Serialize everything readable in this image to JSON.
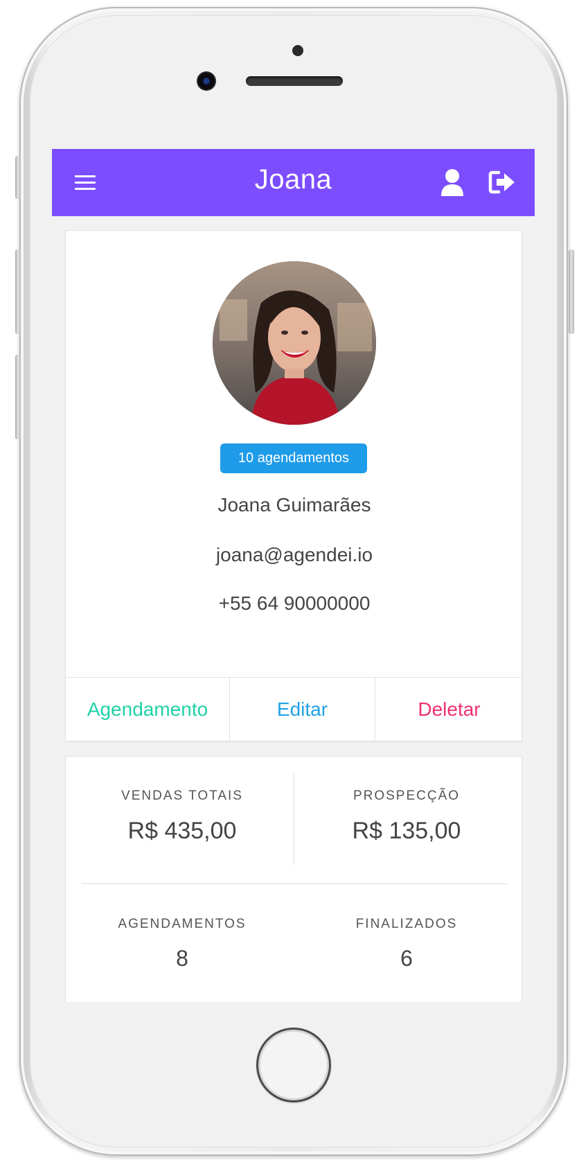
{
  "navbar": {
    "title": "Joana",
    "menu_icon": "menu-icon",
    "user_icon": "user-icon",
    "logout_icon": "logout-icon",
    "color": "#7c4dff"
  },
  "profile": {
    "photo": "profile-photo",
    "badge": "10 agendamentos",
    "name": "Joana Guimarães",
    "email": "joana@agendei.io",
    "phone": "+55 64 90000000"
  },
  "actions": {
    "schedule": "Agendamento",
    "edit": "Editar",
    "delete": "Deletar",
    "schedule_color": "#1fd1a8",
    "edit_color": "#20a2e6",
    "delete_color": "#f0306f"
  },
  "stats": {
    "total_sales_label": "VENDAS TOTAIS",
    "total_sales_value": "R$ 435,00",
    "prospecting_label": "PROSPECÇÃO",
    "prospecting_value": "R$ 135,00",
    "appointments_label": "AGENDAMENTOS",
    "appointments_value": "8",
    "finished_label": "FINALIZADOS",
    "finished_value": "6"
  }
}
